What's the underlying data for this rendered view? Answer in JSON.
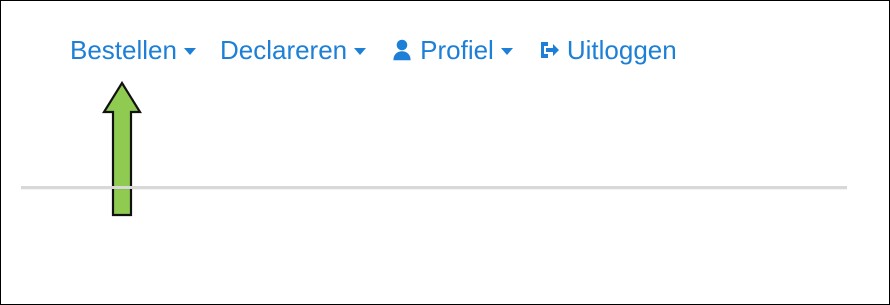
{
  "nav": {
    "items": [
      {
        "label": "Bestellen",
        "icon": "",
        "has_caret": true
      },
      {
        "label": "Declareren",
        "icon": "",
        "has_caret": true
      },
      {
        "label": "Profiel",
        "icon": "user-icon",
        "has_caret": true
      },
      {
        "label": "Uitloggen",
        "icon": "sign-out-icon",
        "has_caret": false
      }
    ]
  },
  "colors": {
    "link": "#1d7fd6",
    "arrow_fill": "#8fcb50",
    "arrow_stroke": "#111111",
    "divider": "#d8d8d8"
  },
  "annotation": {
    "icon": "up-arrow-icon",
    "points_to": "Bestellen"
  }
}
